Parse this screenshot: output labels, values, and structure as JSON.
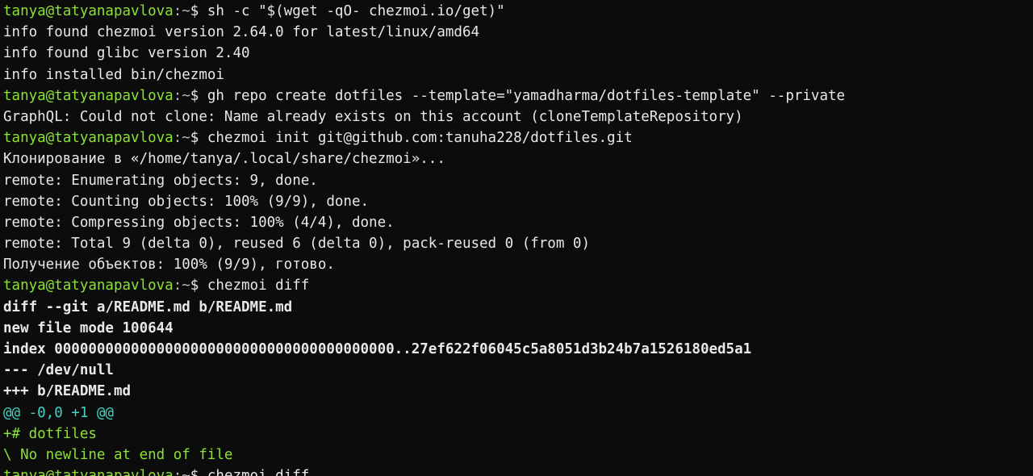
{
  "colors": {
    "background": "#0c0c0c",
    "prompt_user_host": "#8ae234",
    "prompt_path": "#b9bcbf",
    "default_text": "#e8e8e8",
    "diff_hunk": "#3fd7c3",
    "diff_added": "#8ae234"
  },
  "prompt": {
    "user_host": "tanya@tatyanapavlova",
    "path": ":~",
    "symbol": "$ "
  },
  "lines": [
    {
      "kind": "cmd",
      "text": "sh -c \"$(wget -qO- chezmoi.io/get)\""
    },
    {
      "kind": "out",
      "text": "info found chezmoi version 2.64.0 for latest/linux/amd64"
    },
    {
      "kind": "out",
      "text": "info found glibc version 2.40"
    },
    {
      "kind": "out",
      "text": "info installed bin/chezmoi"
    },
    {
      "kind": "cmd",
      "text": "gh repo create dotfiles --template=\"yamadharma/dotfiles-template\" --private"
    },
    {
      "kind": "out",
      "text": "GraphQL: Could not clone: Name already exists on this account (cloneTemplateRepository)"
    },
    {
      "kind": "cmd",
      "text": "chezmoi init git@github.com:tanuha228/dotfiles.git"
    },
    {
      "kind": "out",
      "text": "Клонирование в «/home/tanya/.local/share/chezmoi»..."
    },
    {
      "kind": "out",
      "text": "remote: Enumerating objects: 9, done."
    },
    {
      "kind": "out",
      "text": "remote: Counting objects: 100% (9/9), done."
    },
    {
      "kind": "out",
      "text": "remote: Compressing objects: 100% (4/4), done."
    },
    {
      "kind": "out",
      "text": "remote: Total 9 (delta 0), reused 6 (delta 0), pack-reused 0 (from 0)"
    },
    {
      "kind": "out",
      "text": "Получение объектов: 100% (9/9), готово."
    },
    {
      "kind": "cmd",
      "text": "chezmoi diff"
    },
    {
      "kind": "bold",
      "text": "diff --git a/README.md b/README.md"
    },
    {
      "kind": "bold",
      "text": "new file mode 100644"
    },
    {
      "kind": "bold",
      "text": "index 0000000000000000000000000000000000000000..27ef622f06045c5a8051d3b24b7a1526180ed5a1"
    },
    {
      "kind": "bold",
      "text": "--- /dev/null"
    },
    {
      "kind": "bold",
      "text": "+++ b/README.md"
    },
    {
      "kind": "hunk",
      "text": "@@ -0,0 +1 @@"
    },
    {
      "kind": "add",
      "text": "+# dotfiles"
    },
    {
      "kind": "add",
      "text": "\\ No newline at end of file"
    },
    {
      "kind": "cmd",
      "text": "chezmoi diff"
    }
  ]
}
